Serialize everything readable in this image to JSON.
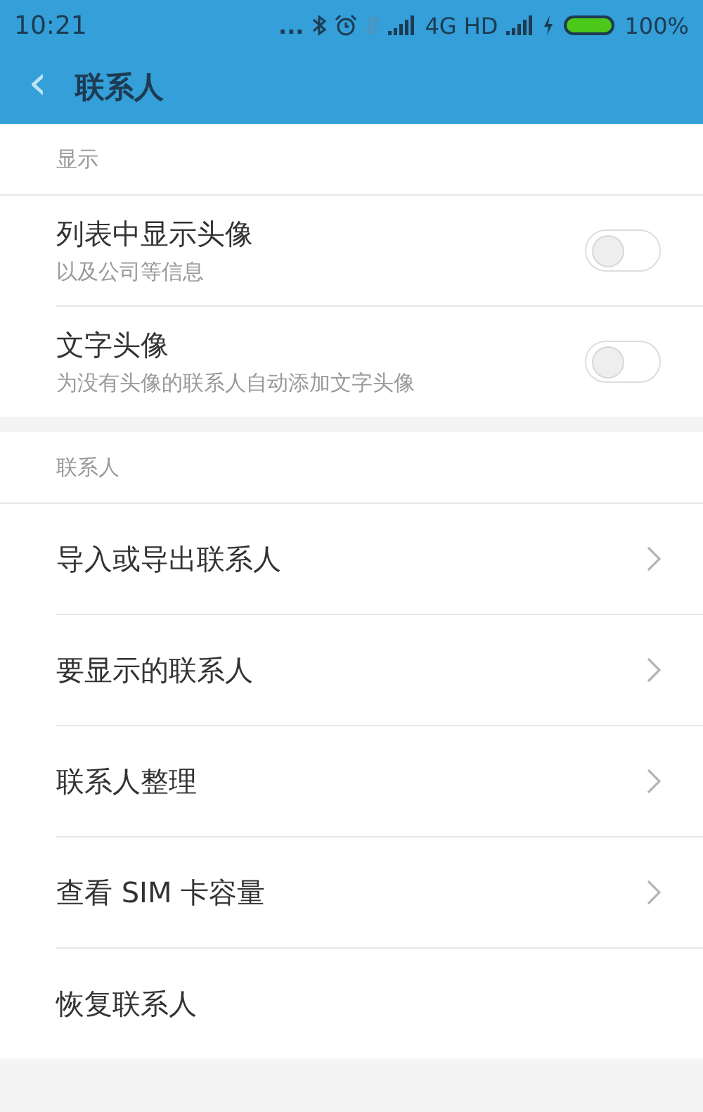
{
  "status_bar": {
    "time": "10:21",
    "dots": "...",
    "network": "4G HD",
    "battery": "100%"
  },
  "app_bar": {
    "back": "‹",
    "title": "联系人"
  },
  "sections": [
    {
      "header": "显示",
      "items": [
        {
          "kind": "toggle",
          "title": "列表中显示头像",
          "subtitle": "以及公司等信息",
          "on": false
        },
        {
          "kind": "toggle",
          "title": "文字头像",
          "subtitle": "为没有头像的联系人自动添加文字头像",
          "on": false
        }
      ]
    },
    {
      "header": "联系人",
      "items": [
        {
          "kind": "link",
          "title": "导入或导出联系人",
          "arrow": true
        },
        {
          "kind": "link",
          "title": "要显示的联系人",
          "arrow": true
        },
        {
          "kind": "link",
          "title": "联系人整理",
          "arrow": true
        },
        {
          "kind": "link",
          "title": "查看 SIM 卡容量",
          "arrow": true
        },
        {
          "kind": "link",
          "title": "恢复联系人",
          "arrow": false
        }
      ]
    }
  ]
}
